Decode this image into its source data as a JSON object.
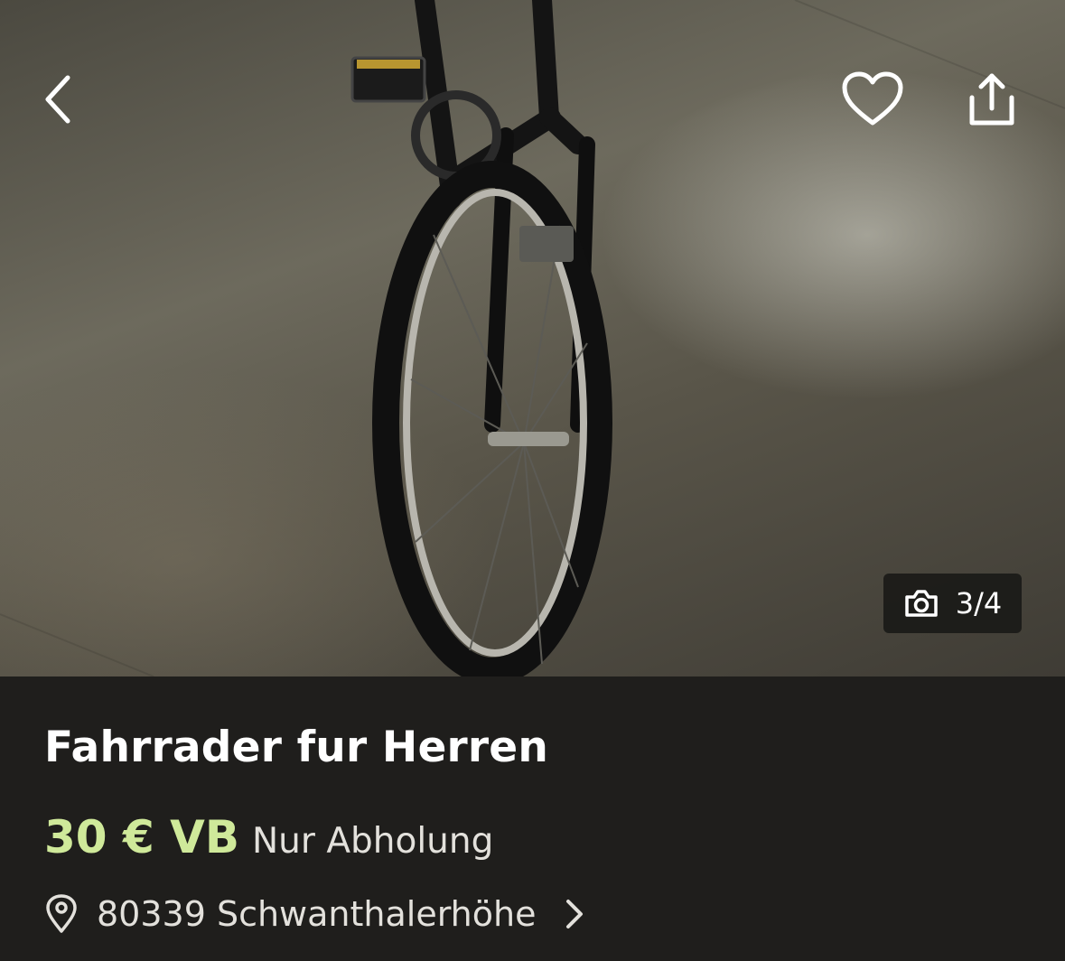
{
  "header": {
    "back_icon": "chevron-left-icon",
    "favorite_icon": "heart-icon",
    "share_icon": "share-icon"
  },
  "gallery": {
    "counter": "3/4",
    "counter_icon": "camera-icon"
  },
  "listing": {
    "title": "Fahrrader fur Herren",
    "price": "30 € VB",
    "shipping": "Nur Abholung",
    "location": "80339 Schwanthalerhöhe"
  },
  "colors": {
    "price_accent": "#cfe99a",
    "background": "#1f1e1c",
    "text_primary": "#ffffff"
  }
}
